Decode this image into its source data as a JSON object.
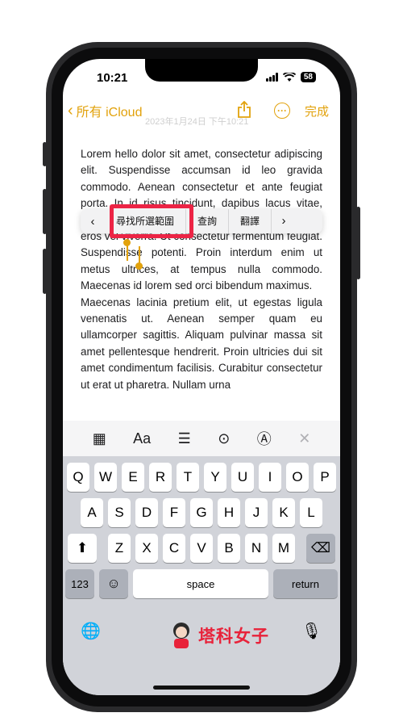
{
  "status": {
    "time": "10:21",
    "battery": "58"
  },
  "nav": {
    "back_label": "所有 iCloud",
    "date": "2023年1月24日 下午10:21",
    "done_label": "完成"
  },
  "note": {
    "text": "Lorem hello dolor sit amet, consectetur adipiscing elit. Suspendisse accumsan id leo gravida commodo. Aenean consectetur et ante feugiat porta. In id risus tincidunt, dapibus lacus vitae, imperdiet ut ut dolor. Aliquam imperdiet ornare eros vel viverra. Ut consectetur fermentum feugiat. Suspendisse potenti. Proin interdum enim ut metus ultrices, at tempus nulla commodo. Maecenas id lorem sed orci bibendum maximus.\nMaecenas lacinia pretium elit, ut egestas ligula venenatis ut. Aenean semper quam eu ullamcorper sagittis. Aliquam pulvinar massa sit amet pellentesque hendrerit. Proin ultricies dui sit amet condimentum facilisis. Curabitur consectetur ut erat ut pharetra. Nullam urna"
  },
  "context_menu": {
    "prev": "‹",
    "items": [
      "尋找所選範圍",
      "查詢",
      "翻譯"
    ],
    "next": "›"
  },
  "toolbar": {
    "items": [
      {
        "name": "table-icon",
        "glyph": "▦"
      },
      {
        "name": "format-icon",
        "glyph": "Aa"
      },
      {
        "name": "checklist-icon",
        "glyph": "☰"
      },
      {
        "name": "camera-icon",
        "glyph": "⊙"
      },
      {
        "name": "markup-icon",
        "glyph": "Ⓐ"
      },
      {
        "name": "close-icon",
        "glyph": "✕"
      }
    ]
  },
  "keyboard": {
    "row1": [
      "Q",
      "W",
      "E",
      "R",
      "T",
      "Y",
      "U",
      "I",
      "O",
      "P"
    ],
    "row2": [
      "A",
      "S",
      "D",
      "F",
      "G",
      "H",
      "J",
      "K",
      "L"
    ],
    "row3": [
      "Z",
      "X",
      "C",
      "V",
      "B",
      "N",
      "M"
    ],
    "shift": "⬆",
    "delete": "⌫",
    "numbers": "123",
    "emoji": "☺",
    "space": "space",
    "return": "return",
    "globe": "🌐",
    "mic": "🎙"
  },
  "watermark": {
    "text": "塔科女子"
  },
  "colors": {
    "accent": "#e2a20c",
    "highlight": "#ec2445"
  }
}
